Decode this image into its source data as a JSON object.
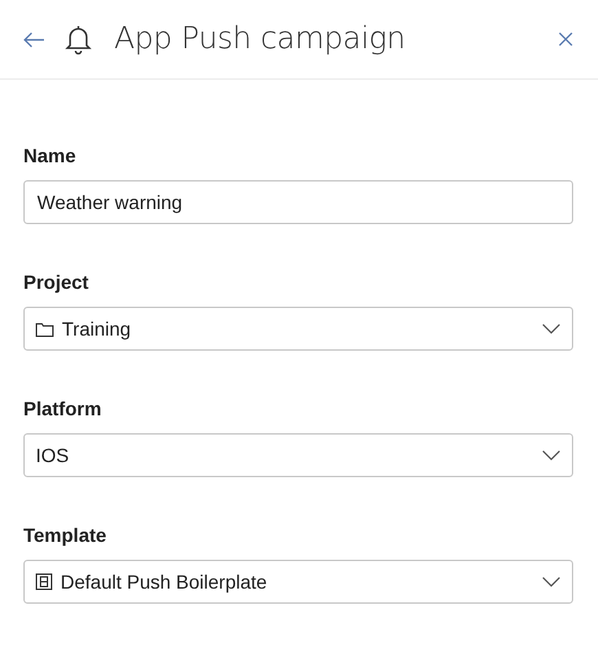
{
  "header": {
    "title": "App Push campaign"
  },
  "fields": [
    {
      "label": "Name",
      "kind": "text",
      "value": "Weather warning"
    },
    {
      "label": "Project",
      "kind": "folder",
      "value": "Training"
    },
    {
      "label": "Platform",
      "kind": "select",
      "value": "IOS"
    },
    {
      "label": "Template",
      "kind": "template",
      "value": "Default Push Boilerplate"
    }
  ]
}
